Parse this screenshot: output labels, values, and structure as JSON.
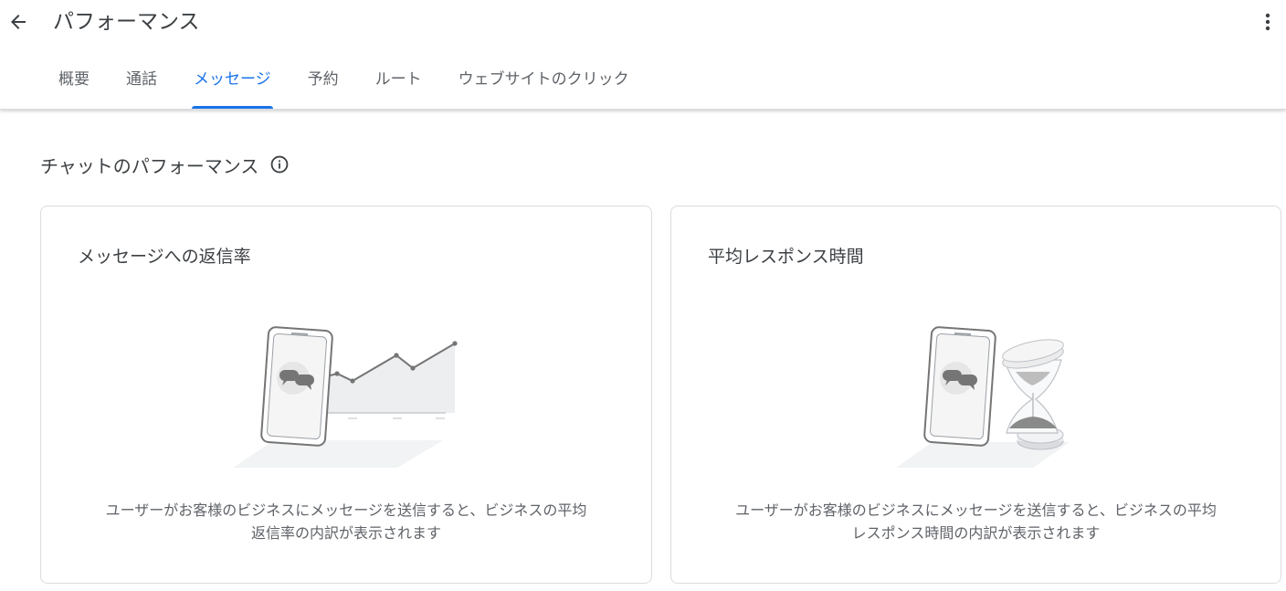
{
  "header": {
    "title": "パフォーマンス",
    "back_icon": "arrow-back-icon",
    "more_icon": "more-vert-icon"
  },
  "tabs": [
    {
      "label": "概要",
      "active": false
    },
    {
      "label": "通話",
      "active": false
    },
    {
      "label": "メッセージ",
      "active": true
    },
    {
      "label": "予約",
      "active": false
    },
    {
      "label": "ルート",
      "active": false
    },
    {
      "label": "ウェブサイトのクリック",
      "active": false
    }
  ],
  "section": {
    "title": "チャットのパフォーマンス",
    "info_icon": "info-icon"
  },
  "cards": [
    {
      "title": "メッセージへの返信率",
      "description_line1": "ユーザーがお客様のビジネスにメッセージを送信すると、ビジネスの平均",
      "description_line2": "返信率の内訳が表示されます",
      "illustration_icon": "phone-chat-trend-illustration"
    },
    {
      "title": "平均レスポンス時間",
      "description_line1": "ユーザーがお客様のビジネスにメッセージを送信すると、ビジネスの平均",
      "description_line2": "レスポンス時間の内訳が表示されます",
      "illustration_icon": "phone-hourglass-illustration"
    }
  ],
  "colors": {
    "accent": "#1a73e8",
    "text": "#3c4043",
    "secondary_text": "#5f6368",
    "border": "#dadce0"
  }
}
